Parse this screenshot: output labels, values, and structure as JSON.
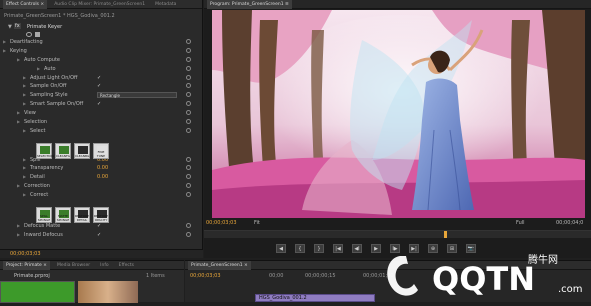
{
  "effect_controls": {
    "tabs": [
      "Effect Controls ×",
      "Audio Clip Mixer: Primate_GreenScreen1",
      "Metadata"
    ],
    "clip_path": "Primate_GreenScreen1 * HGS_Godiva_001.2",
    "effect_name": "Primate Keyer",
    "rows": [
      {
        "label": "Deartifacting",
        "indent": 10
      },
      {
        "label": "Keying",
        "indent": 10
      },
      {
        "label": "Auto Compute",
        "indent": 24
      },
      {
        "label": "Auto",
        "indent": 44
      },
      {
        "label": "Adjust Light On/Off",
        "indent": 30,
        "check": "✓"
      },
      {
        "label": "Sample On/Off",
        "indent": 30,
        "check": "✓"
      },
      {
        "label": "Sampling Style",
        "indent": 30,
        "select": "Rectangle"
      },
      {
        "label": "Smart Sample On/Off",
        "indent": 30,
        "check": "✓"
      },
      {
        "label": "View",
        "indent": 24
      },
      {
        "label": "Selection",
        "indent": 24
      },
      {
        "label": "Select",
        "indent": 30
      },
      {
        "label": "Spill",
        "indent": 30,
        "value": "0.00"
      },
      {
        "label": "Transparency",
        "indent": 30,
        "value": "0.00"
      },
      {
        "label": "Detail",
        "indent": 30,
        "value": "0.00"
      },
      {
        "label": "Correction",
        "indent": 24
      },
      {
        "label": "Correct",
        "indent": 30
      },
      {
        "label": "Defocus Matte",
        "indent": 24,
        "check": "✓"
      },
      {
        "label": "Inward Defocus",
        "indent": 24,
        "check": "✓"
      }
    ],
    "select_buttons": [
      "SELECTION",
      "CLEANFG",
      "CLEANBG",
      "FINE TUNE"
    ],
    "correct_buttons": [
      "SPILL SPONGE",
      "MATTE SPONGE",
      "RESTORE DETAIL",
      "RESTORE OPACITY"
    ],
    "timecode": "00;00;03;03"
  },
  "program_monitor": {
    "title": "Program: Primate_GreenScreen1 ≡",
    "timecode_left": "00;00;03;03",
    "fit_label": "Fit",
    "full_label": "Full",
    "timecode_right": "00;00;04;0"
  },
  "transport_buttons": [
    "◀",
    "{",
    "}",
    "|◀",
    "◀I",
    "▶",
    "I▶",
    "▶|",
    "⊕",
    "⊞",
    "📷"
  ],
  "project": {
    "tabs": [
      "Project: Primate ×",
      "Media Browser",
      "Info",
      "Effects"
    ],
    "item_label": "Primate.prproj",
    "items_count": "1 Items"
  },
  "timeline": {
    "tab": "Primate_GreenScreen1 ×",
    "timecode": "00;00;03;03",
    "ticks": [
      "00;00",
      "00;00;00;15",
      "00;00;01;00"
    ],
    "clip_name": "HGS_Godiva_001.2"
  },
  "watermark": {
    "brand": "QQTN",
    "site": "腾牛网",
    "domain": ".com"
  }
}
